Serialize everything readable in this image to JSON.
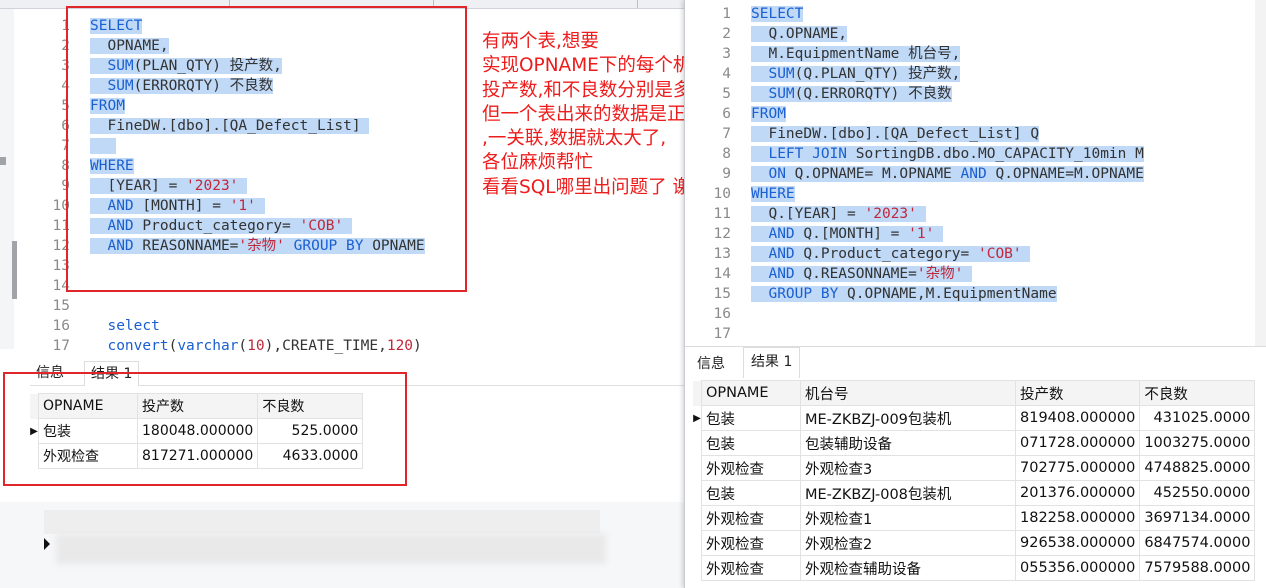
{
  "left_editor": {
    "lines": [
      {
        "n": "1",
        "hl": true,
        "parts": [
          [
            "kw",
            "SELECT"
          ]
        ]
      },
      {
        "n": "2",
        "hl": true,
        "parts": [
          [
            "txt",
            "  OPNAME,"
          ]
        ]
      },
      {
        "n": "3",
        "hl": true,
        "parts": [
          [
            "fn",
            "  SUM"
          ],
          [
            "txt",
            "(PLAN_QTY) 投产数,"
          ]
        ]
      },
      {
        "n": "4",
        "hl": true,
        "parts": [
          [
            "fn",
            "  SUM"
          ],
          [
            "txt",
            "(ERRORQTY) 不良数"
          ]
        ]
      },
      {
        "n": "5",
        "hl": true,
        "parts": [
          [
            "kw",
            "FROM"
          ]
        ]
      },
      {
        "n": "6",
        "hl": true,
        "parts": [
          [
            "txt",
            "  FineDW.[dbo].[QA_Defect_List] "
          ]
        ]
      },
      {
        "n": "7",
        "hl": true,
        "parts": [
          [
            "txt",
            "   "
          ]
        ]
      },
      {
        "n": "8",
        "hl": true,
        "parts": [
          [
            "kw",
            "WHERE"
          ]
        ]
      },
      {
        "n": "9",
        "hl": true,
        "parts": [
          [
            "txt",
            "  [YEAR] = "
          ],
          [
            "str",
            "'2023'"
          ],
          [
            "txt",
            " "
          ]
        ]
      },
      {
        "n": "10",
        "hl": true,
        "parts": [
          [
            "kw",
            "  AND"
          ],
          [
            "txt",
            " [MONTH] = "
          ],
          [
            "str",
            "'1'"
          ],
          [
            "txt",
            " "
          ]
        ]
      },
      {
        "n": "11",
        "hl": true,
        "parts": [
          [
            "kw",
            "  AND"
          ],
          [
            "txt",
            " Product_category= "
          ],
          [
            "str",
            "'COB'"
          ],
          [
            "txt",
            " "
          ]
        ]
      },
      {
        "n": "12",
        "hl": true,
        "parts": [
          [
            "kw",
            "  AND"
          ],
          [
            "txt",
            " REASONNAME="
          ],
          [
            "str",
            "'杂物'"
          ],
          [
            "txt",
            " "
          ],
          [
            "kw",
            "GROUP BY"
          ],
          [
            "txt",
            " OPNAME"
          ]
        ]
      },
      {
        "n": "13",
        "hl": false,
        "parts": []
      },
      {
        "n": "14",
        "hl": false,
        "parts": []
      },
      {
        "n": "15",
        "hl": false,
        "parts": []
      },
      {
        "n": "16",
        "hl": false,
        "parts": [
          [
            "kw",
            "  select"
          ]
        ]
      },
      {
        "n": "17",
        "hl": false,
        "parts": [
          [
            "fn",
            "  convert"
          ],
          [
            "txt",
            "("
          ],
          [
            "kw",
            "varchar"
          ],
          [
            "txt",
            "("
          ],
          [
            "num",
            "10"
          ],
          [
            "txt",
            "),CREATE_TIME,"
          ],
          [
            "num",
            "120"
          ],
          [
            "txt",
            ")"
          ]
        ]
      }
    ]
  },
  "left_results": {
    "tab_info": "信息",
    "tab_result": "结果 1",
    "headers": [
      "OPNAME",
      "投产数",
      "不良数"
    ],
    "rows": [
      [
        "包装",
        "180048.000000",
        "525.0000"
      ],
      [
        "外观检查",
        "817271.000000",
        "4633.0000"
      ]
    ]
  },
  "annotation": {
    "text": "有两个表,想要\n实现OPNAME下的每个机台号\n投产数,和不良数分别是多少,\n但一个表出来的数据是正确的\n,一关联,数据就太大了,\n各位麻烦帮忙\n看看SQL哪里出问题了 谢谢",
    "color": "#ee1c1c"
  },
  "right_editor": {
    "lines": [
      {
        "n": "1",
        "hl": true,
        "parts": [
          [
            "kw",
            "SELECT"
          ]
        ]
      },
      {
        "n": "2",
        "hl": true,
        "parts": [
          [
            "txt",
            "  Q.OPNAME,"
          ]
        ]
      },
      {
        "n": "3",
        "hl": true,
        "parts": [
          [
            "txt",
            "  M.EquipmentName 机台号,"
          ]
        ]
      },
      {
        "n": "4",
        "hl": true,
        "parts": [
          [
            "fn",
            "  SUM"
          ],
          [
            "txt",
            "(Q.PLAN_QTY) 投产数,"
          ]
        ]
      },
      {
        "n": "5",
        "hl": true,
        "parts": [
          [
            "fn",
            "  SUM"
          ],
          [
            "txt",
            "(Q.ERRORQTY) 不良数"
          ]
        ]
      },
      {
        "n": "6",
        "hl": true,
        "parts": [
          [
            "kw",
            "FROM"
          ]
        ]
      },
      {
        "n": "7",
        "hl": true,
        "parts": [
          [
            "txt",
            "  FineDW.[dbo].[QA_Defect_List] Q"
          ]
        ]
      },
      {
        "n": "8",
        "hl": true,
        "parts": [
          [
            "kw",
            "  LEFT JOIN"
          ],
          [
            "txt",
            " SortingDB.dbo.MO_CAPACITY_10min M"
          ]
        ]
      },
      {
        "n": "9",
        "hl": true,
        "parts": [
          [
            "kw",
            "  ON"
          ],
          [
            "txt",
            " Q.OPNAME= M.OPNAME "
          ],
          [
            "kw",
            "AND"
          ],
          [
            "txt",
            " Q.OPNAME=M.OPNAME"
          ]
        ]
      },
      {
        "n": "10",
        "hl": true,
        "parts": [
          [
            "kw",
            "WHERE"
          ]
        ]
      },
      {
        "n": "11",
        "hl": true,
        "parts": [
          [
            "txt",
            "  Q.[YEAR] = "
          ],
          [
            "str",
            "'2023'"
          ],
          [
            "txt",
            " "
          ]
        ]
      },
      {
        "n": "12",
        "hl": true,
        "parts": [
          [
            "kw",
            "  AND"
          ],
          [
            "txt",
            " Q.[MONTH] = "
          ],
          [
            "str",
            "'1'"
          ],
          [
            "txt",
            " "
          ]
        ]
      },
      {
        "n": "13",
        "hl": true,
        "parts": [
          [
            "kw",
            "  AND"
          ],
          [
            "txt",
            " Q.Product_category= "
          ],
          [
            "str",
            "'COB'"
          ],
          [
            "txt",
            " "
          ]
        ]
      },
      {
        "n": "14",
        "hl": true,
        "parts": [
          [
            "kw",
            "  AND"
          ],
          [
            "txt",
            " Q.REASONNAME="
          ],
          [
            "str",
            "'杂物'"
          ],
          [
            "txt",
            " "
          ]
        ]
      },
      {
        "n": "15",
        "hl": true,
        "parts": [
          [
            "kw",
            "  GROUP BY"
          ],
          [
            "txt",
            " Q.OPNAME,M.EquipmentName"
          ]
        ]
      },
      {
        "n": "16",
        "hl": false,
        "parts": []
      },
      {
        "n": "17",
        "hl": false,
        "parts": []
      }
    ]
  },
  "right_results": {
    "tab_info": "信息",
    "tab_result": "结果 1",
    "headers": [
      "OPNAME",
      "机台号",
      "投产数",
      "不良数"
    ],
    "rows": [
      [
        "包装",
        "ME-ZKBZJ-009包装机",
        "819408.000000",
        "431025.0000"
      ],
      [
        "包装",
        "包装辅助设备",
        "071728.000000",
        "1003275.0000"
      ],
      [
        "外观检查",
        "外观检查3",
        "702775.000000",
        "4748825.0000"
      ],
      [
        "包装",
        "ME-ZKBZJ-008包装机",
        "201376.000000",
        "452550.0000"
      ],
      [
        "外观检查",
        "外观检查1",
        "182258.000000",
        "3697134.0000"
      ],
      [
        "外观检查",
        "外观检查2",
        "926538.000000",
        "6847574.0000"
      ],
      [
        "外观检查",
        "外观检查辅助设备",
        "055356.000000",
        "7579588.0000"
      ]
    ]
  },
  "colors": {
    "selection": "#bfd9f7",
    "keyword": "#1a5fd1",
    "string": "#c0283b",
    "annotation_red": "#e0262a"
  }
}
